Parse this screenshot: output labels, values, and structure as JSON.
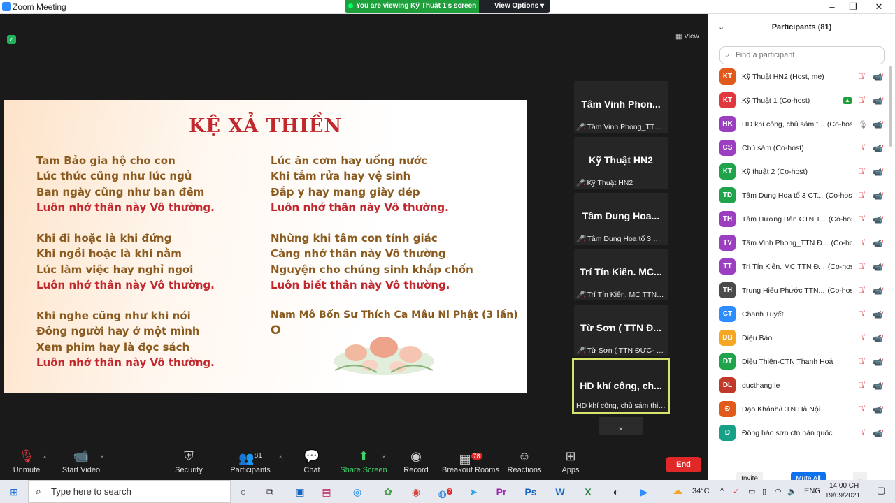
{
  "window": {
    "title": "Zoom Meeting",
    "minimize": "–",
    "maximize": "❐",
    "close": "✕"
  },
  "banner": {
    "viewing": "You are viewing Kỹ Thuật 1's screen",
    "view_options": "View Options ▾"
  },
  "stage": {
    "view_label": "View"
  },
  "slide": {
    "title": "KỆ XẢ THIỀN",
    "left_column": [
      {
        "lines": [
          "Tam Bảo gia hộ cho con",
          "Lúc thức cũng như lúc ngủ",
          "Ban ngày cũng như ban đêm"
        ],
        "refrain": "Luôn nhớ thân này Vô thường."
      },
      {
        "lines": [
          "Khi đi hoặc là khi đứng",
          "Khi ngồi hoặc là khi nằm",
          "Lúc làm việc hay nghỉ ngơi"
        ],
        "refrain": "Luôn nhớ thân này Vô thường."
      },
      {
        "lines": [
          "Khi nghe cũng như khi nói",
          "Đông người hay ở một mình",
          "Xem phim hay là đọc sách"
        ],
        "refrain": "Luôn nhớ thân này Vô thường."
      }
    ],
    "right_column": [
      {
        "lines": [
          "Lúc ăn cơm hay uống nước",
          "Khi tắm rửa hay vệ sinh",
          "Đắp y hay mang giày dép"
        ],
        "refrain": "Luôn nhớ thân này Vô thường."
      },
      {
        "lines": [
          "Những khi tâm con tỉnh giác",
          "Càng nhớ thân này Vô thường",
          "Nguyện cho chúng sinh khắp chốn"
        ],
        "refrain": "Luôn biết thân này Vô thường."
      }
    ],
    "closing": "Nam Mô Bổn Sư Thích Ca Mâu Ni Phật (3 lần)",
    "bell_glyph": "O"
  },
  "video_tiles": [
    {
      "name": "Tâm Vinh Phon...",
      "sub": "Tâm Vinh Phong_TTN ..."
    },
    {
      "name": "Kỹ Thuật HN2",
      "sub": "Kỹ Thuật HN2"
    },
    {
      "name": "Tâm Dung Hoa...",
      "sub": "Tâm Dung Hoa tổ 3 CT..."
    },
    {
      "name": "Trí Tín Kiên. MC...",
      "sub": "Trí Tín Kiên. MC  TTN Đ..."
    },
    {
      "name": "Từ Sơn ( TTN Đ...",
      "sub": "Từ Sơn ( TTN ĐỨC- NG..."
    },
    {
      "name": "HD khí công, ch...",
      "sub": "HD khí công, chủ sám thiền"
    }
  ],
  "toolbar": {
    "unmute": "Unmute",
    "start_video": "Start Video",
    "security": "Security",
    "participants": "Participants",
    "participants_count": "81",
    "chat": "Chat",
    "share_screen": "Share Screen",
    "record": "Record",
    "breakout_rooms": "Breakout Rooms",
    "breakout_badge": "78",
    "reactions": "Reactions",
    "apps": "Apps",
    "end": "End"
  },
  "panel": {
    "title": "Participants (81)",
    "search_placeholder": "Find a participant",
    "participants": [
      {
        "initials": "KT",
        "color": "#e05a1c",
        "name": "Kỹ Thuật HN2 (Host, me)",
        "role": ""
      },
      {
        "initials": "KT",
        "color": "#e0383e",
        "name": "Kỹ Thuật 1  (Co-host)",
        "role": "",
        "sharing": true
      },
      {
        "initials": "HK",
        "color": "#9b3fc0",
        "name": "HD khí công, chủ sám t...",
        "role": "(Co-host)",
        "mic_on": true
      },
      {
        "initials": "CS",
        "color": "#9b3fc0",
        "name": "Chủ sám  (Co-host)",
        "role": ""
      },
      {
        "initials": "KT",
        "color": "#20a34a",
        "name": "Kỹ thuật 2  (Co-host)",
        "role": ""
      },
      {
        "initials": "TD",
        "color": "#20a34a",
        "name": "Tâm Dung Hoa tổ 3 CT...",
        "role": "(Co-host)"
      },
      {
        "initials": "TH",
        "color": "#9b3fc0",
        "name": "Tâm Hương Bản CTN T...",
        "role": "(Co-host)"
      },
      {
        "initials": "TV",
        "color": "#9b3fc0",
        "name": "Tâm Vinh Phong_TTN Đ...",
        "role": "(Co-host)"
      },
      {
        "initials": "TT",
        "color": "#9b3fc0",
        "name": "Trí Tín Kiên. MC  TTN Đ...",
        "role": "(Co-host)"
      },
      {
        "initials": "TH",
        "color": "#4a4a4a",
        "name": "Trung Hiếu Phước TTN...",
        "role": "(Co-host)"
      },
      {
        "initials": "CT",
        "color": "#2d8cff",
        "name": "Chanh Tuyết",
        "role": ""
      },
      {
        "initials": "DB",
        "color": "#f5a623",
        "name": "Diệu Bảo",
        "role": ""
      },
      {
        "initials": "DT",
        "color": "#20a34a",
        "name": "Diệu Thiện-CTN Thanh Hoá",
        "role": ""
      },
      {
        "initials": "DL",
        "color": "#c0392b",
        "name": "ducthang le",
        "role": ""
      },
      {
        "initials": "Đ",
        "color": "#e05a1c",
        "name": "Đạo Khánh/CTN Hà Nội",
        "role": ""
      },
      {
        "initials": "Đ",
        "color": "#16a085",
        "name": "Đồng hảo sơn ctn hàn quốc",
        "role": ""
      }
    ],
    "invite": "Invite",
    "mute_all": "Mute All",
    "more": "..."
  },
  "taskbar": {
    "search_placeholder": "Type here to search",
    "weather": "34°C",
    "lang": "ENG",
    "time": "14:00 CH",
    "date": "19/09/2021",
    "chrome_badge": "2"
  },
  "colors": {
    "host_red": "#c1272d",
    "verse_brown": "#8a5a1e",
    "zoom_blue": "#2d8cff",
    "end_red": "#e02828",
    "share_green": "#1e9f3c"
  }
}
